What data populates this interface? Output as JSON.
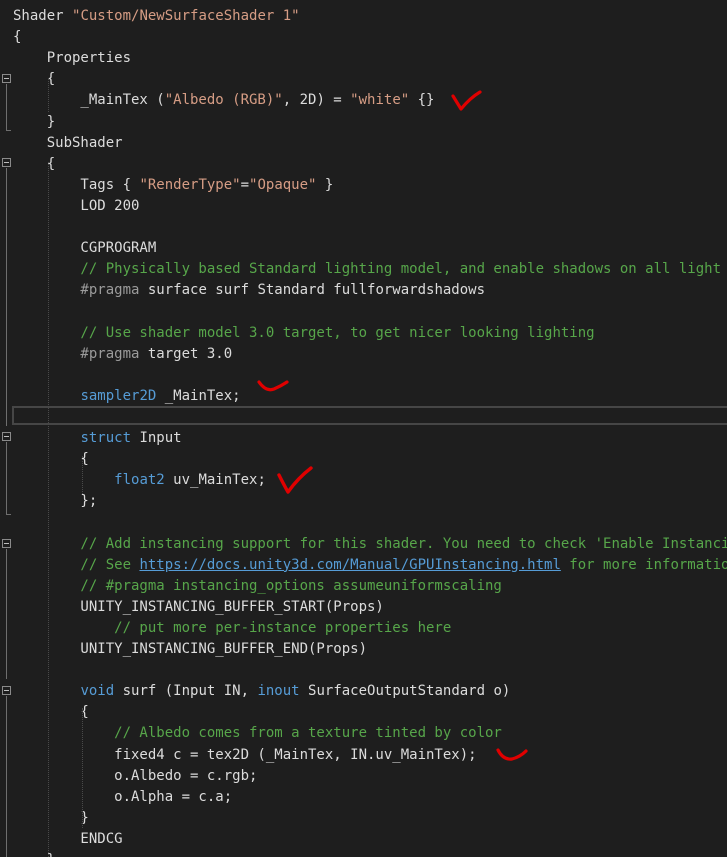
{
  "editor": {
    "lines": [
      [
        {
          "t": "Shader ",
          "c": "plain"
        },
        {
          "t": "\"Custom/NewSurfaceShader 1\"",
          "c": "string"
        }
      ],
      [
        {
          "t": "{",
          "c": "plain"
        }
      ],
      [
        {
          "t": "    Properties",
          "c": "plain"
        }
      ],
      [
        {
          "t": "    {",
          "c": "plain"
        }
      ],
      [
        {
          "t": "        _MainTex (",
          "c": "plain"
        },
        {
          "t": "\"Albedo (RGB)\"",
          "c": "string"
        },
        {
          "t": ", 2D) = ",
          "c": "plain"
        },
        {
          "t": "\"white\"",
          "c": "string"
        },
        {
          "t": " {}",
          "c": "plain"
        }
      ],
      [
        {
          "t": "    }",
          "c": "plain"
        }
      ],
      [
        {
          "t": "    SubShader",
          "c": "plain"
        }
      ],
      [
        {
          "t": "    {",
          "c": "plain"
        }
      ],
      [
        {
          "t": "        Tags { ",
          "c": "plain"
        },
        {
          "t": "\"RenderType\"",
          "c": "string"
        },
        {
          "t": "=",
          "c": "plain"
        },
        {
          "t": "\"Opaque\"",
          "c": "string"
        },
        {
          "t": " }",
          "c": "plain"
        }
      ],
      [
        {
          "t": "        LOD 200",
          "c": "plain"
        }
      ],
      [],
      [
        {
          "t": "        CGPROGRAM",
          "c": "plain"
        }
      ],
      [
        {
          "t": "        // Physically based Standard lighting model, and enable shadows on all light types",
          "c": "comment"
        }
      ],
      [
        {
          "t": "        #pragma",
          "c": "macro"
        },
        {
          "t": " surface surf Standard fullforwardshadows",
          "c": "plain"
        }
      ],
      [],
      [
        {
          "t": "        // Use shader model 3.0 target, to get nicer looking lighting",
          "c": "comment"
        }
      ],
      [
        {
          "t": "        #pragma",
          "c": "macro"
        },
        {
          "t": " target 3.0",
          "c": "plain"
        }
      ],
      [],
      [
        {
          "t": "        ",
          "c": "plain"
        },
        {
          "t": "sampler2D",
          "c": "keyword"
        },
        {
          "t": " _MainTex;",
          "c": "plain"
        }
      ],
      [],
      [
        {
          "t": "        ",
          "c": "plain"
        },
        {
          "t": "struct",
          "c": "keyword"
        },
        {
          "t": " Input",
          "c": "plain"
        }
      ],
      [
        {
          "t": "        {",
          "c": "plain"
        }
      ],
      [
        {
          "t": "            ",
          "c": "plain"
        },
        {
          "t": "float2",
          "c": "keyword"
        },
        {
          "t": " uv_MainTex;",
          "c": "plain"
        }
      ],
      [
        {
          "t": "        };",
          "c": "plain"
        }
      ],
      [],
      [
        {
          "t": "        // Add instancing support for this shader. You need to check 'Enable Instancing' on materials that use the shader.",
          "c": "comment"
        }
      ],
      [
        {
          "t": "        // See ",
          "c": "comment"
        },
        {
          "t": "https://docs.unity3d.com/Manual/GPUInstancing.html",
          "c": "link"
        },
        {
          "t": " for more information about instancing.",
          "c": "comment"
        }
      ],
      [
        {
          "t": "        // #pragma instancing_options assumeuniformscaling",
          "c": "comment"
        }
      ],
      [
        {
          "t": "        UNITY_INSTANCING_BUFFER_START(Props)",
          "c": "plain"
        }
      ],
      [
        {
          "t": "            // put more per-instance properties here",
          "c": "comment"
        }
      ],
      [
        {
          "t": "        UNITY_INSTANCING_BUFFER_END(Props)",
          "c": "plain"
        }
      ],
      [],
      [
        {
          "t": "        ",
          "c": "plain"
        },
        {
          "t": "void",
          "c": "keyword"
        },
        {
          "t": " surf (Input IN, ",
          "c": "plain"
        },
        {
          "t": "inout",
          "c": "keyword"
        },
        {
          "t": " SurfaceOutputStandard o)",
          "c": "plain"
        }
      ],
      [
        {
          "t": "        {",
          "c": "plain"
        }
      ],
      [
        {
          "t": "            // Albedo comes from a texture tinted by color",
          "c": "comment"
        }
      ],
      [
        {
          "t": "            fixed4 c = tex2D (_MainTex, IN.uv_MainTex);",
          "c": "plain"
        }
      ],
      [
        {
          "t": "            o.Albedo = c.rgb;",
          "c": "plain"
        }
      ],
      [
        {
          "t": "            o.Alpha = c.a;",
          "c": "plain"
        }
      ],
      [
        {
          "t": "        }",
          "c": "plain"
        }
      ],
      [
        {
          "t": "        ENDCG",
          "c": "plain"
        }
      ],
      [
        {
          "t": "    }",
          "c": "plain"
        }
      ]
    ]
  },
  "annotations": {
    "color": "#e00000",
    "marks": [
      "checkmark",
      "short-tick",
      "checkmark",
      "short-tick"
    ]
  },
  "theme": {
    "background": "#1e1e1e",
    "text": "#dcdcdc",
    "string": "#d69d85",
    "comment": "#57a64a",
    "keyword": "#569cd6",
    "macro": "#9b9b9b"
  }
}
